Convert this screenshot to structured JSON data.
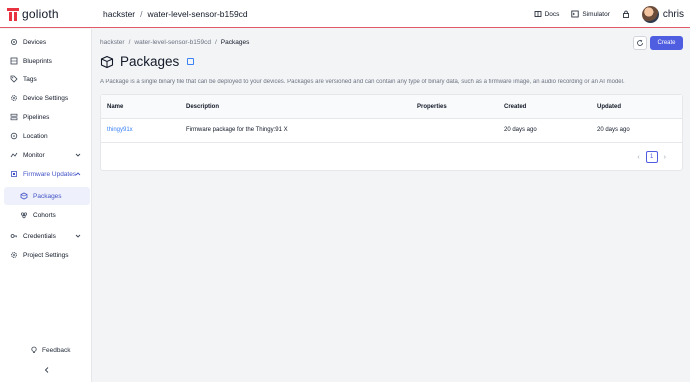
{
  "app": {
    "logo_text": "golioth"
  },
  "header": {
    "org": "hackster",
    "project": "water-level-sensor-b159cd",
    "docs_label": "Docs",
    "simulator_label": "Simulator",
    "user_name": "chris"
  },
  "sidebar": {
    "items": [
      {
        "label": "Devices",
        "icon": "devices-icon"
      },
      {
        "label": "Blueprints",
        "icon": "blueprint-icon"
      },
      {
        "label": "Tags",
        "icon": "tag-icon"
      },
      {
        "label": "Device Settings",
        "icon": "settings-icon"
      },
      {
        "label": "Pipelines",
        "icon": "pipeline-icon"
      },
      {
        "label": "Location",
        "icon": "location-icon"
      },
      {
        "label": "Monitor",
        "icon": "monitor-icon"
      },
      {
        "label": "Firmware Updates",
        "icon": "firmware-icon"
      },
      {
        "label": "Packages",
        "icon": "package-icon"
      },
      {
        "label": "Cohorts",
        "icon": "cohort-icon"
      },
      {
        "label": "Credentials",
        "icon": "key-icon"
      },
      {
        "label": "Project Settings",
        "icon": "project-settings-icon"
      }
    ],
    "feedback_label": "Feedback",
    "accent_color": "#4353c6"
  },
  "main": {
    "breadcrumb": [
      "hackster",
      "water-level-sensor-b159cd",
      "Packages"
    ],
    "title": "Packages",
    "description": "A Package is a single binary file that can be deployed to your devices. Packages are versioned and can contain any type of binary data, such as a firmware image, an audio recording or an AI model.",
    "create_label": "Create",
    "table": {
      "columns": [
        "Name",
        "Description",
        "Properties",
        "Created",
        "Updated"
      ],
      "rows": [
        {
          "name": "thingy91x",
          "description": "Firmware package for the Thingy:91 X",
          "properties": "",
          "created": "20 days ago",
          "updated": "20 days ago"
        }
      ]
    },
    "pagination": {
      "current_page": "1"
    }
  }
}
